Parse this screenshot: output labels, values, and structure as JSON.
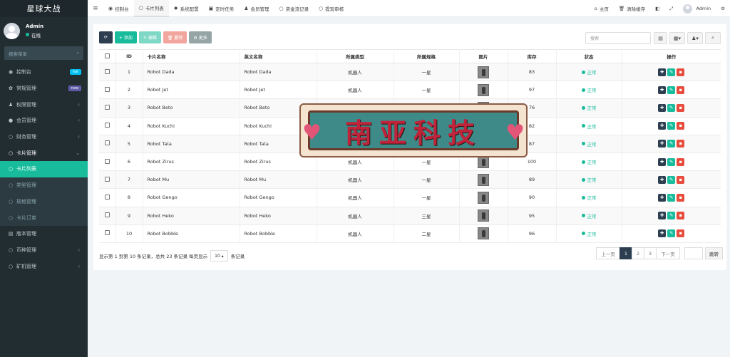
{
  "sidebar": {
    "brand": "星球大战",
    "user": {
      "name": "Admin",
      "status": "在线"
    },
    "search_placeholder": "搜索菜单",
    "items": [
      {
        "label": "控制台",
        "icon": "dashboard-icon",
        "glyph": "◉",
        "badge": "hot",
        "badge_color": "#00c0ef"
      },
      {
        "label": "常规管理",
        "icon": "cogs-icon",
        "glyph": "✿",
        "badge": "new",
        "badge_color": "#605ca8"
      },
      {
        "label": "权限管理",
        "icon": "group-icon",
        "glyph": "♟",
        "arrow": "‹"
      },
      {
        "label": "会员管理",
        "icon": "user-icon",
        "glyph": "●",
        "arrow": "‹"
      },
      {
        "label": "财务管理",
        "icon": "circle-icon",
        "glyph": "○",
        "arrow": "‹"
      },
      {
        "label": "卡片管理",
        "icon": "circle-icon",
        "glyph": "○",
        "arrow": "⌄"
      },
      {
        "label": "卡片列表",
        "icon": "circle-icon",
        "glyph": "○"
      },
      {
        "label": "类型管理",
        "icon": "circle-icon",
        "glyph": "○"
      },
      {
        "label": "规格管理",
        "icon": "circle-icon",
        "glyph": "○"
      },
      {
        "label": "卡片订单",
        "icon": "circle-icon",
        "glyph": "○"
      },
      {
        "label": "版本管理",
        "icon": "file-icon",
        "glyph": "▤"
      },
      {
        "label": "币种管理",
        "icon": "circle-icon",
        "glyph": "○",
        "arrow": "‹"
      },
      {
        "label": "矿机管理",
        "icon": "circle-icon",
        "glyph": "○",
        "arrow": "‹"
      }
    ]
  },
  "topbar": {
    "tabs": [
      {
        "label": "控制台",
        "icon": "dashboard-icon",
        "glyph": "◉"
      },
      {
        "label": "卡片列表",
        "icon": "circle-icon",
        "glyph": "○"
      },
      {
        "label": "系统配置",
        "icon": "gear-icon",
        "glyph": "✹"
      },
      {
        "label": "定时任务",
        "icon": "task-icon",
        "glyph": "▣"
      },
      {
        "label": "会员管理",
        "icon": "user-icon",
        "glyph": "♟"
      },
      {
        "label": "资金流记录",
        "icon": "circle-icon",
        "glyph": "○"
      },
      {
        "label": "提现审核",
        "icon": "circle-icon",
        "glyph": "○"
      }
    ],
    "home": "主页",
    "clear_cache": "清除缓存",
    "admin": "Admin"
  },
  "toolbar": {
    "refresh": "⟳",
    "add": "+ 添加",
    "edit": "✎ 编辑",
    "delete": "🗑 删除",
    "more": "⚙ 更多",
    "search_placeholder": "搜索"
  },
  "table": {
    "headers": [
      "ID",
      "卡片名称",
      "英文名称",
      "所属类型",
      "所属规格",
      "图片",
      "库存",
      "状态",
      "操作"
    ],
    "rows": [
      {
        "id": "1",
        "name": "Robot Dada",
        "en": "Robot Dada",
        "type": "机器人",
        "spec": "一星",
        "stock": "83",
        "status": "正常"
      },
      {
        "id": "2",
        "name": "Robot Jet",
        "en": "Robot Jet",
        "type": "机器人",
        "spec": "一星",
        "stock": "97",
        "status": "正常"
      },
      {
        "id": "3",
        "name": "Robot Beto",
        "en": "Robot Beto",
        "type": "",
        "spec": "",
        "stock": "76",
        "status": "正常"
      },
      {
        "id": "4",
        "name": "Robot Kuchi",
        "en": "Robot Kuchi",
        "type": "",
        "spec": "",
        "stock": "82",
        "status": "正常"
      },
      {
        "id": "5",
        "name": "Robot Tata",
        "en": "Robot Tata",
        "type": "",
        "spec": "",
        "stock": "87",
        "status": "正常"
      },
      {
        "id": "6",
        "name": "Robot Zirus",
        "en": "Robot Zirus",
        "type": "机器人",
        "spec": "一星",
        "stock": "100",
        "status": "正常"
      },
      {
        "id": "7",
        "name": "Robot Mu",
        "en": "Robot Mu",
        "type": "机器人",
        "spec": "一星",
        "stock": "89",
        "status": "正常"
      },
      {
        "id": "8",
        "name": "Robot Gengo",
        "en": "Robot Gengo",
        "type": "机器人",
        "spec": "一星",
        "stock": "90",
        "status": "正常"
      },
      {
        "id": "9",
        "name": "Robot Heko",
        "en": "Robot Heko",
        "type": "机器人",
        "spec": "三星",
        "stock": "95",
        "status": "正常"
      },
      {
        "id": "10",
        "name": "Robot Bobble",
        "en": "Robot Bobble",
        "type": "机器人",
        "spec": "二星",
        "stock": "96",
        "status": "正常"
      }
    ]
  },
  "footer": {
    "info": "显示第 1 到第 10 条记录，总共 23 条记录 每页显示",
    "page_size": "10 ▴",
    "suffix": "条记录",
    "prev": "上一页",
    "pages": [
      "1",
      "2",
      "3"
    ],
    "next": "下一页",
    "jump": "跳转"
  },
  "watermark": {
    "text": "南亚科技"
  },
  "colors": {
    "accent": "#18bc9c",
    "sidebar": "#222d32",
    "dark": "#2c3e50",
    "danger": "#e74c3c"
  }
}
